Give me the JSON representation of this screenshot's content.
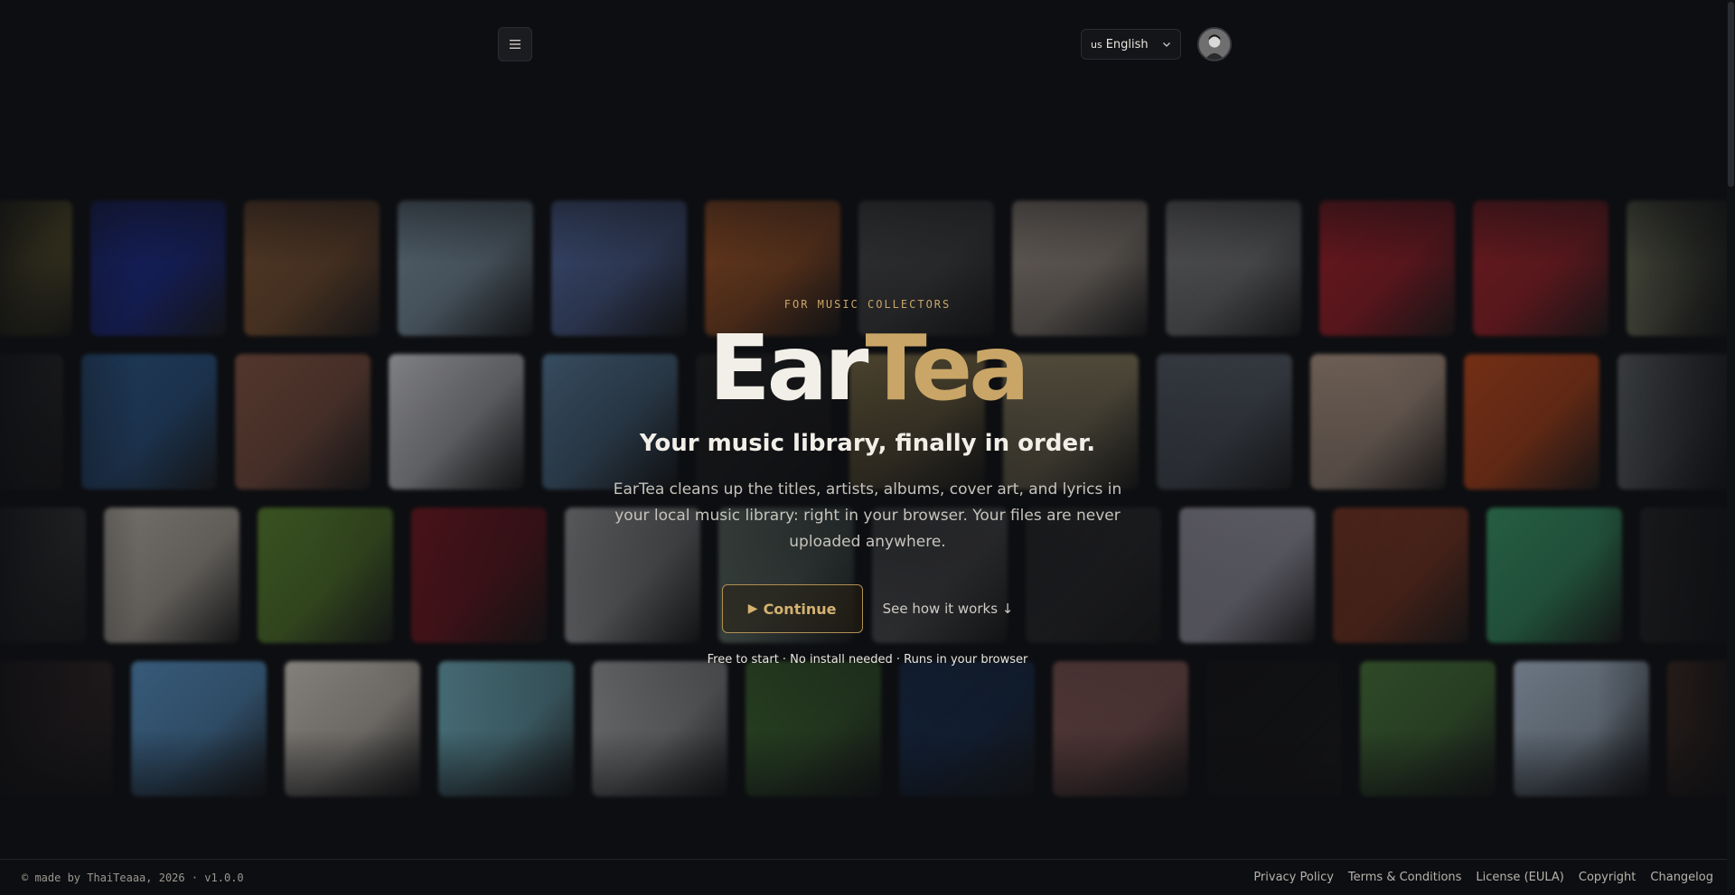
{
  "header": {
    "menu_icon": "hamburger-menu-icon",
    "language": {
      "flag_code": "us",
      "label": "English"
    },
    "avatar_icon": "user-avatar"
  },
  "hero": {
    "eyebrow": "FOR MUSIC COLLECTORS",
    "brand_part1": "Ear",
    "brand_part2": "Tea",
    "tagline": "Your music library, finally in order.",
    "description": "EarTea cleans up the titles, artists, albums, cover art, and lyrics in your local music library: right in your browser. Your files are never uploaded anywhere.",
    "continue_label": "Continue",
    "continue_icon": "play-icon",
    "how_label": "See how it works ↓",
    "perks": "Free to start · No install needed · Runs in your browser"
  },
  "colors": {
    "background": "#0d0e11",
    "accent": "#c9a667",
    "text": "#f2efe8"
  },
  "album_wall": {
    "rows": [
      [
        "#c9b54a",
        "#1d2fa0",
        "#8a5a35",
        "#8aa3b5",
        "#5e78b8",
        "#d06a2a",
        "#5a5a5a",
        "#c7b8a8",
        "#8d8d8d",
        "#b4202a",
        "#b3242a",
        "#8a8d6a"
      ],
      [
        "#3a3a3a",
        "#2e5f96",
        "#8c5844",
        "#e6e6ea",
        "#6d9fc8",
        "#2a2a2a",
        "#d0b46a",
        "#d2c08a",
        "#6b7480",
        "#c8ab95",
        "#c84a1a",
        "#6a6e72"
      ],
      [
        "#4a4a4a",
        "#c9c1b4",
        "#5e8a2e",
        "#8a1822",
        "#e0e0e0",
        "#a6c4b0",
        "#8f8f8f",
        "#3a3a3a",
        "#d8d5e6",
        "#8a3a22",
        "#3aa06a",
        "#2a2a2a"
      ],
      [
        "#3a2a2a",
        "#5a9ad0",
        "#e4dccf",
        "#7ec6d6",
        "#d8d8d8",
        "#4e8a3a",
        "#1a3a6a",
        "#b0706a",
        "#151515",
        "#4a7a3a",
        "#b8cce0",
        "#5a3a2a"
      ]
    ]
  },
  "footer": {
    "credit": "© made by ThaiTeaaa, 2026 · v1.0.0",
    "links": [
      "Privacy Policy",
      "Terms & Conditions",
      "License (EULA)",
      "Copyright",
      "Changelog"
    ]
  }
}
